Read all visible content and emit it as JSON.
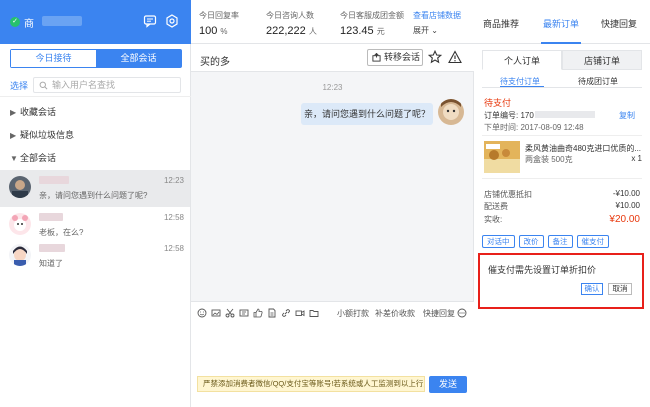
{
  "app": {
    "shop_prefix": "商",
    "icons": [
      "chat-bubble-icon",
      "settings-gear-icon"
    ]
  },
  "left": {
    "seg_today": "今日接待",
    "seg_all": "全部会话",
    "select_label": "选择",
    "search_placeholder": "输入用户名查找",
    "groups": [
      {
        "label": "收藏会话",
        "state": "collapsed"
      },
      {
        "label": "疑似垃圾信息",
        "state": "collapsed"
      },
      {
        "label": "全部会话",
        "state": "expanded"
      }
    ],
    "chats": [
      {
        "msg": "亲，请问您遇到什么问题了呢?",
        "time": "12:23"
      },
      {
        "msg": "老板，在么?",
        "time": "12:58"
      },
      {
        "msg": "知道了",
        "time": "12:58"
      }
    ]
  },
  "stats": {
    "reply_rate_label": "今日回复率",
    "reply_rate_value": "100",
    "reply_rate_unit": "%",
    "inquiries_label": "今日咨询人数",
    "inquiries_value": "222,222",
    "inquiries_unit": "人",
    "sales_label": "今日客服成团金额",
    "sales_value": "123.45",
    "sales_unit": "元",
    "view_data_link": "查看店铺数据",
    "expand_label": "展开"
  },
  "conversation": {
    "name": "买的多",
    "transfer_label": "转移会话",
    "timestamp": "12:23",
    "message": "亲，请问您遇到什么问题了呢？"
  },
  "composer": {
    "small_tip_label": "小额打款",
    "refund_label": "补差价收款",
    "quick_reply_label": "快捷回复",
    "notice": "严禁添加消费者微信/QQ/支付宝等账号!若系统或人工监测到以上行为",
    "send_label": "发送"
  },
  "right": {
    "tab_recommend": "商品推荐",
    "tab_latest_order": "最新订单",
    "tab_quick_reply": "快捷回复",
    "sub_personal": "个人订单",
    "sub_shop": "店铺订单",
    "subsub_pending": "待支付订单",
    "subsub_group": "待成团订单",
    "order": {
      "status": "待支付",
      "order_no_label": "订单编号: 170",
      "copy_label": "复制",
      "order_time": "下单时间: 2017-08-09 12:48",
      "product_name": "柔风黄油曲奇480克进口优质的...",
      "product_price": "¥10",
      "product_spec": "两盒装 500克",
      "product_qty": "x 1",
      "shop_discount_label": "店铺优惠抵扣",
      "shop_discount_value": "-¥10.00",
      "shipping_label": "配送费",
      "shipping_value": "¥10.00",
      "paid_label": "实收:",
      "paid_value": "¥20.00",
      "actions": [
        "对话中",
        "改价",
        "备注",
        "催支付"
      ]
    }
  },
  "popup": {
    "text": "催支付需先设置订单折扣价",
    "confirm_label": "确认",
    "cancel_label": "取消"
  },
  "colors": {
    "accent": "#3b84f0",
    "alert": "#e8380d",
    "highlight_border": "#e8201a"
  }
}
